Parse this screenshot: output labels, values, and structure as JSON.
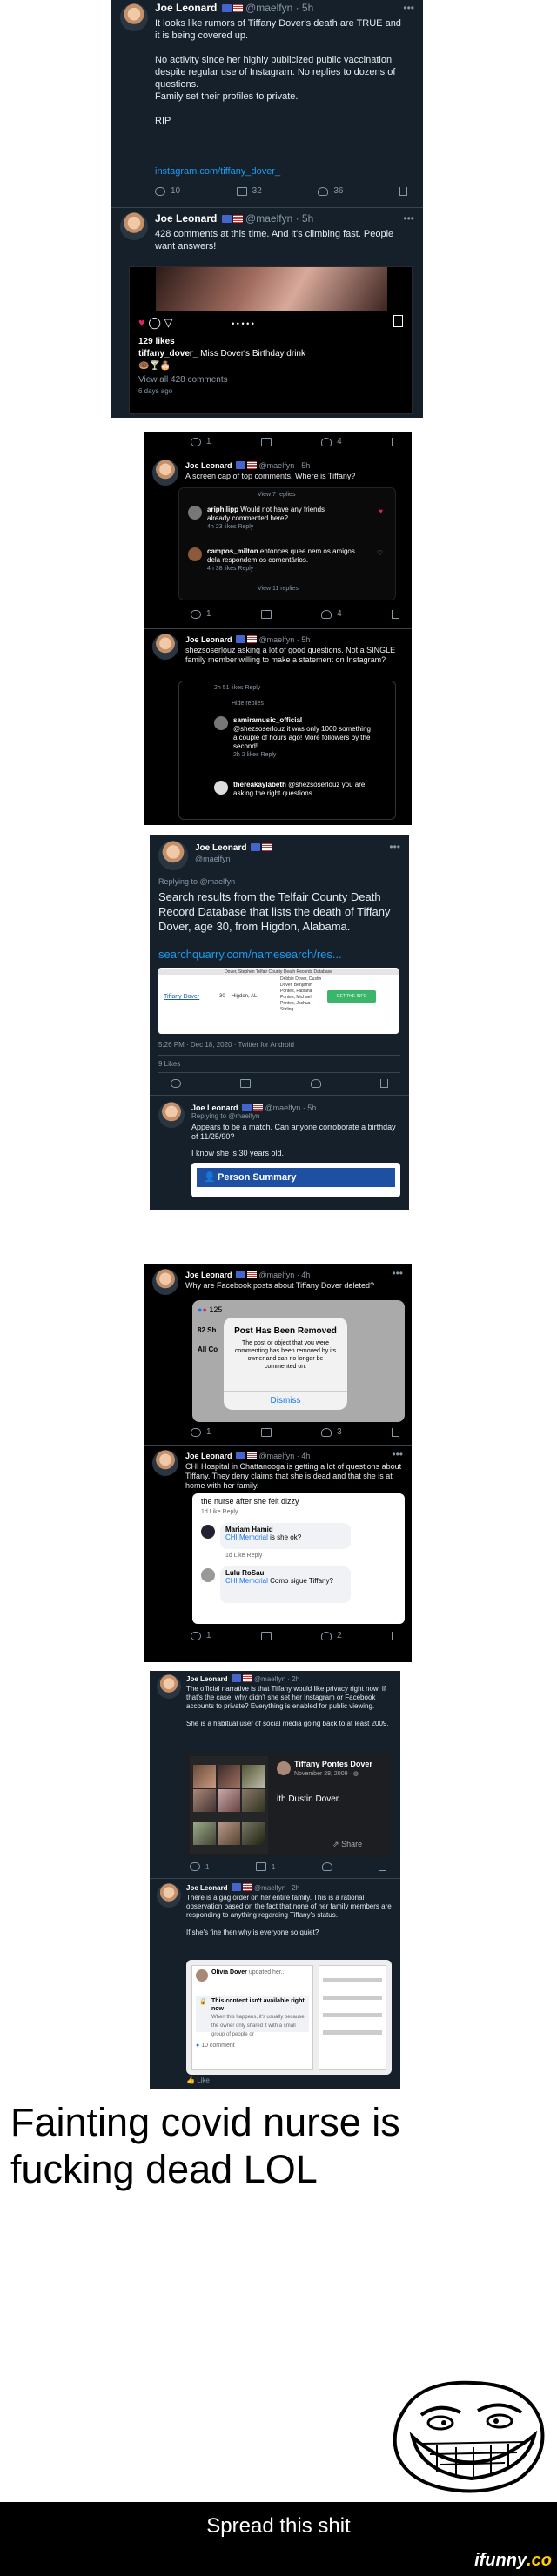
{
  "panel1": {
    "tweet1": {
      "name": "Joe Leonard",
      "handle_time": "@maelfyn · 5h",
      "text": "It looks like rumors of Tiffany Dover's death are TRUE and it is being covered up.\n\nNo activity since her highly publicized public vaccination despite regular use of Instagram. No replies to dozens of questions.\nFamily set their profiles to private.\n\nRIP",
      "link": "instagram.com/tiffany_dover_",
      "replies": "10",
      "retweets": "32",
      "likes": "36"
    },
    "tweet2": {
      "name": "Joe Leonard",
      "handle_time": "@maelfyn · 5h",
      "text": "428 comments at this time. And it's climbing fast. People want answers!",
      "ig_likes": "129 likes",
      "ig_caption_user": "tiffany_dover_",
      "ig_caption": "Miss Dover's Birthday drink",
      "ig_emoji": "🍩🍸🎂",
      "ig_view": "View all 428 comments",
      "ig_time": "6 days ago"
    }
  },
  "panel2": {
    "top_actions": {
      "replies": "1",
      "likes": "4"
    },
    "tweet1": {
      "name": "Joe Leonard",
      "handle_time": "@maelfyn · 5h",
      "text": "A screen cap of top comments. Where is Tiffany?",
      "view_replies": "View 7 replies",
      "c1_user": "ariphilipp",
      "c1_text": "Would not have any friends already commented here?",
      "c1_meta": "4h   23 likes   Reply",
      "c2_user": "campos_milton",
      "c2_text": "entonces quee nem os amigos dela respondem os comentários.",
      "c2_meta": "4h   38 likes   Reply",
      "view_more": "View 11 replies",
      "replies": "1",
      "likes": "4"
    },
    "tweet2": {
      "name": "Joe Leonard",
      "handle_time": "@maelfyn · 5h",
      "text": "shezsoserlouz asking a lot of good questions. Not a SINGLE family member willing to make a statement on Instagram?",
      "meta_top": "2h   51 likes   Reply",
      "hide": "Hide replies",
      "c1_user": "samiramusic_official",
      "c1_text": "@shezsoserlouz it was only 1000 something a couple of hours ago! More followers by the second!",
      "c1_meta": "2h   2 likes   Reply",
      "c2_user": "thereakaylabeth",
      "c2_text": "@shezsoserlouz you are asking the right questions."
    }
  },
  "panel3": {
    "name": "Joe Leonard",
    "handle": "@maelfyn",
    "replying": "Replying to @maelfyn",
    "text": "Search results from the Telfair County Death Record Database that lists the death of Tiffany Dover, age 30, from Higdon, Alabama.",
    "link": "searchquarry.com/namesearch/res...",
    "db_header": "Dover, Stephen Telfair County Death Records Database",
    "db_name": "Tiffany Dover",
    "db_age": "30",
    "db_city": "Higdon, AL",
    "db_relatives": "Debbie Dover, Dustin Dover, Benjamin Pontes, Fabiana Pontes, Michael Pontes, Joshua Stirling",
    "db_button": "GET THE INFO",
    "meta": "5:26 PM · Dec 18, 2020 · Twitter for Android",
    "likes": "9 Likes",
    "reply": {
      "name": "Joe Leonard",
      "handle_time": "@maelfyn · 5h",
      "replying": "Replying to @maelfyn",
      "text": "Appears to be a match. Can anyone corroborate a birthday of 11/25/90?",
      "text2": "I know she is 30 years old.",
      "button": "Person Summary"
    }
  },
  "panel4": {
    "tweet1": {
      "name": "Joe Leonard",
      "handle_time": "@maelfyn · 4h",
      "text": "Why are Facebook posts about Tiffany Dover deleted?",
      "count": "125",
      "side1": "82 Sh",
      "side2": "All Co",
      "dlg_title": "Post Has Been Removed",
      "dlg_body": "The post or object that you were commenting has been removed by its owner and can no longer be commented on.",
      "dlg_button": "Dismiss",
      "replies": "1",
      "retweets": "3"
    },
    "tweet2": {
      "name": "Joe Leonard",
      "handle_time": "@maelfyn · 4h",
      "text": "CHI Hospital in Chattanooga is getting a lot of questions about Tiffany. They deny claims that she is dead and that she is at home with her family.",
      "fb_top": "the nurse after she felt dizzy",
      "fb_meta1": "1d   Like   Reply",
      "c1_user": "Mariam Hamid",
      "c1_link": "CHI Memorial",
      "c1_text": " is she ok?",
      "c1_meta": "1d   Like   Reply",
      "c2_user": "Lulu RoSau",
      "c2_link": "CHI Memorial",
      "c2_text": " Como sigue Tiffany?",
      "replies": "1",
      "likes": "2"
    }
  },
  "panel5": {
    "tweet1": {
      "name": "Joe Leonard",
      "handle_time": "@maelfyn · 2h",
      "text": "The official narrative is that Tiffany would like privacy right now. If that's the case, why didn't she set her Instagram or Facebook accounts to private? Everything is enabled for public viewing.\n\nShe is a habitual user of social media going back to at least 2009.",
      "fb_name": "Tiffany Pontes Dover",
      "fb_date": "November 28, 2009 · ",
      "fb_with": "ith Dustin Dover.",
      "fb_share": "Share",
      "replies": "1",
      "retweets": "1"
    },
    "tweet2": {
      "name": "Joe Leonard",
      "handle_time": "@maelfyn · 2h",
      "text": "There is a gag order on her entire family. This is a rational observation based on the fact that none of her family members are responding to anything regarding Tiffany's status.\n\nIf she's fine then why is everyone so quiet?",
      "p1_name": "Olivia Dover",
      "p1_sub": "updated her...",
      "p2_text": "This content isn't available right now",
      "p2_sub": "When this happens, it's usually because the owner only shared it with a small group of people or",
      "p3_text": "10 comment",
      "like": "Like"
    }
  },
  "caption": "Fainting covid nurse is fucking dead LOL",
  "footer": {
    "spread": "Spread this shit",
    "brand_main": "ifunny",
    "brand_suffix": ".co"
  }
}
